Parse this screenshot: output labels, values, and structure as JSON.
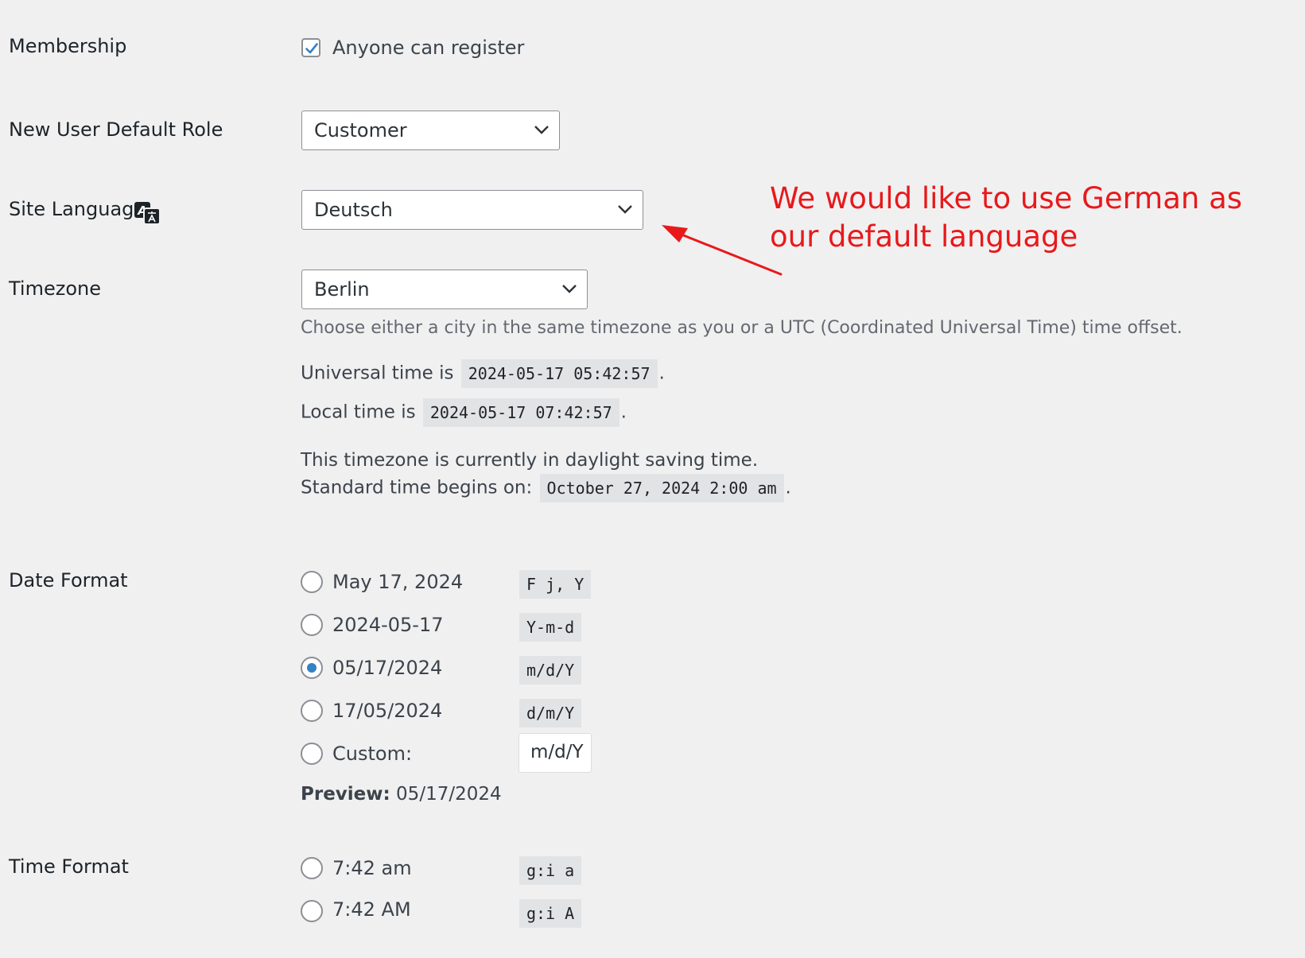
{
  "membership": {
    "label": "Membership",
    "checkbox_label": "Anyone can register",
    "checked": true
  },
  "default_role": {
    "label": "New User Default Role",
    "value": "Customer"
  },
  "site_language": {
    "label": "Site Language",
    "value": "Deutsch"
  },
  "timezone": {
    "label": "Timezone",
    "value": "Berlin",
    "description": "Choose either a city in the same timezone as you or a UTC (Coordinated Universal Time) time offset.",
    "universal_prefix": "Universal time is",
    "universal_value": "2024-05-17 05:42:57",
    "local_prefix": "Local time is",
    "local_value": "2024-05-17 07:42:57",
    "dst_line": "This timezone is currently in daylight saving time.",
    "standard_prefix": "Standard time begins on:",
    "standard_value": "October 27, 2024 2:00 am",
    "period": "."
  },
  "date_format": {
    "label": "Date Format",
    "options": [
      {
        "text": "May 17, 2024",
        "code": "F j, Y",
        "selected": false
      },
      {
        "text": "2024-05-17",
        "code": "Y-m-d",
        "selected": false
      },
      {
        "text": "05/17/2024",
        "code": "m/d/Y",
        "selected": true
      },
      {
        "text": "17/05/2024",
        "code": "d/m/Y",
        "selected": false
      }
    ],
    "custom_label": "Custom:",
    "custom_value": "m/d/Y",
    "preview_label": "Preview:",
    "preview_value": "05/17/2024"
  },
  "time_format": {
    "label": "Time Format",
    "options": [
      {
        "text": "7:42 am",
        "code": "g:i a",
        "selected": false
      },
      {
        "text": "7:42 AM",
        "code": "g:i A",
        "selected": false
      }
    ]
  },
  "annotation": {
    "line1": "We would like to use German as",
    "line2": "our default language",
    "color": "#e8191b"
  },
  "colors": {
    "background": "#f0f0f1",
    "accent": "#3582c4"
  }
}
